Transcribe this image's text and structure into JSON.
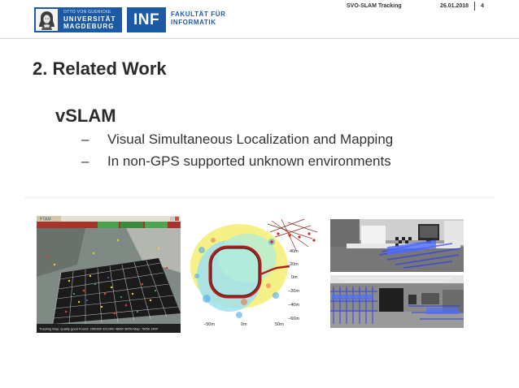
{
  "header": {
    "university": {
      "sub": "OTTO VON GUERICKE",
      "line1": "UNIVERSITÄT",
      "line2": "MAGDEBURG"
    },
    "inf_logo": "INF",
    "faculty": {
      "line1": "FAKULTÄT FÜR",
      "line2": "INFORMATIK"
    },
    "presentation_title": "SVO-SLAM Tracking",
    "date": "26.01.2018",
    "page_number": "4",
    "brand_color": "#1d5aa6"
  },
  "slide": {
    "title": "2. Related Work",
    "topic": "vSLAM",
    "bullets": [
      "Visual Simultaneous Localization and Mapping",
      "In non-GPS supported unknown environments"
    ]
  },
  "figures": {
    "ptam": {
      "window_title": "PTAM",
      "status_text": "Tracking Map: quality good Found: 299/300 321/340 48/60 30/50 Map: 78/50 14KF"
    },
    "trajectory_map": {
      "tick_labels_y": [
        "40m",
        "20m",
        "0m",
        "−20m",
        "−40m",
        "−60m"
      ],
      "tick_labels_x": [
        "−50m",
        "0m",
        "50m"
      ]
    },
    "kitchen_scene": {},
    "office_scene": {}
  }
}
